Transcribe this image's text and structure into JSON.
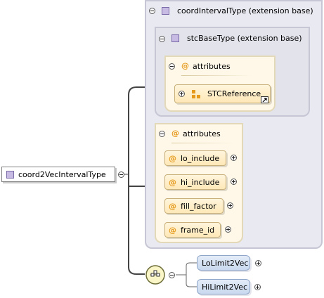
{
  "root": {
    "type_name": "coord2VecIntervalType"
  },
  "outer_box": {
    "title": "coordIntervalType (extension base)"
  },
  "inner_box": {
    "title": "stcBaseType (extension base)"
  },
  "inner_attributes": {
    "title": "attributes",
    "group_ref": "STCReference"
  },
  "attributes": {
    "title": "attributes",
    "items": [
      "lo_include",
      "hi_include",
      "fill_factor",
      "frame_id"
    ]
  },
  "elements": [
    "LoLimit2Vec",
    "HiLimit2Vec"
  ],
  "colors": {
    "type_box_bg": "#e9e9f1",
    "attribute_bg": "#fff8e8",
    "element_bg": "#c9d9ef",
    "attribute_icon": "#e59a1c"
  }
}
